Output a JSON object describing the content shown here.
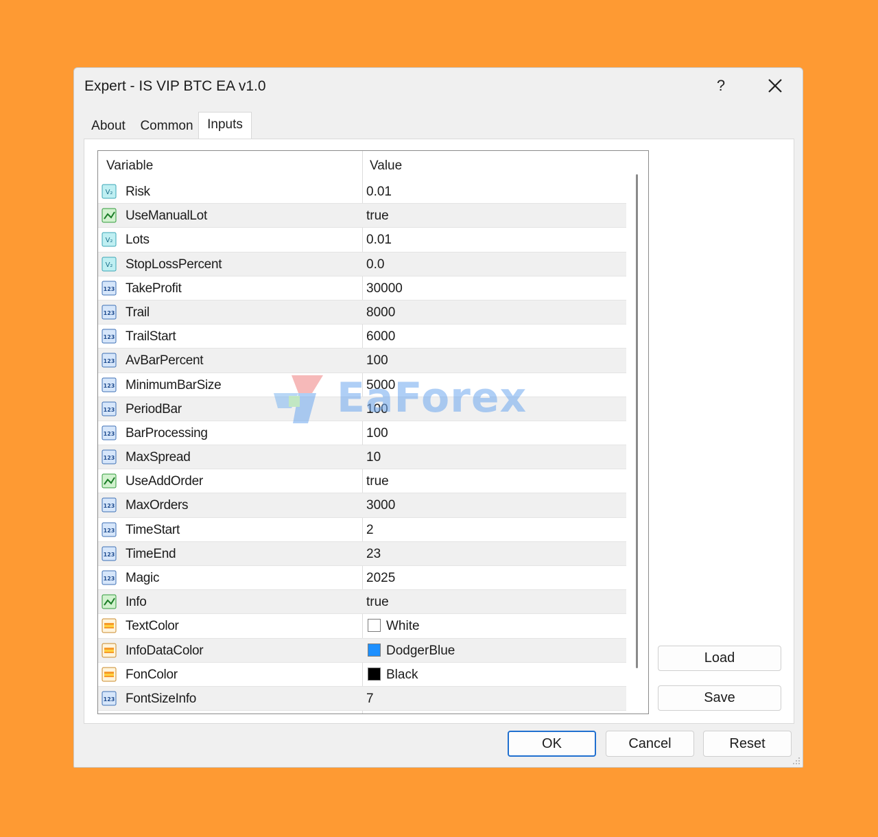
{
  "window": {
    "title": "Expert - IS VIP BTC EA v1.0",
    "help_label": "?",
    "close_label": "✕"
  },
  "tabs": [
    {
      "label": "About",
      "active": false
    },
    {
      "label": "Common",
      "active": false
    },
    {
      "label": "Inputs",
      "active": true
    }
  ],
  "grid": {
    "headers": {
      "variable": "Variable",
      "value": "Value"
    },
    "rows": [
      {
        "variable": "Risk",
        "value": "0.01",
        "icon": "double-icon"
      },
      {
        "variable": "UseManualLot",
        "value": "true",
        "icon": "bool-icon"
      },
      {
        "variable": "Lots",
        "value": "0.01",
        "icon": "double-icon"
      },
      {
        "variable": "StopLossPercent",
        "value": "0.0",
        "icon": "double-icon"
      },
      {
        "variable": "TakeProfit",
        "value": "30000",
        "icon": "int-icon"
      },
      {
        "variable": "Trail",
        "value": "8000",
        "icon": "int-icon"
      },
      {
        "variable": "TrailStart",
        "value": "6000",
        "icon": "int-icon"
      },
      {
        "variable": "AvBarPercent",
        "value": "100",
        "icon": "int-icon"
      },
      {
        "variable": "MinimumBarSize",
        "value": "5000",
        "icon": "int-icon"
      },
      {
        "variable": "PeriodBar",
        "value": "100",
        "icon": "int-icon"
      },
      {
        "variable": "BarProcessing",
        "value": "100",
        "icon": "int-icon"
      },
      {
        "variable": "MaxSpread",
        "value": "10",
        "icon": "int-icon"
      },
      {
        "variable": "UseAddOrder",
        "value": "true",
        "icon": "bool-icon"
      },
      {
        "variable": "MaxOrders",
        "value": "3000",
        "icon": "int-icon"
      },
      {
        "variable": "TimeStart",
        "value": "2",
        "icon": "int-icon"
      },
      {
        "variable": "TimeEnd",
        "value": "23",
        "icon": "int-icon"
      },
      {
        "variable": "Magic",
        "value": "2025",
        "icon": "int-icon"
      },
      {
        "variable": "Info",
        "value": "true",
        "icon": "bool-icon"
      },
      {
        "variable": "TextColor",
        "value": "White",
        "icon": "color-icon",
        "swatch": "#FFFFFF"
      },
      {
        "variable": "InfoDataColor",
        "value": "DodgerBlue",
        "icon": "color-icon",
        "swatch": "#1E90FF"
      },
      {
        "variable": "FonColor",
        "value": "Black",
        "icon": "color-icon",
        "swatch": "#000000"
      },
      {
        "variable": "FontSizeInfo",
        "value": "7",
        "icon": "int-icon"
      }
    ]
  },
  "side_buttons": {
    "load": "Load",
    "save": "Save"
  },
  "footer_buttons": {
    "ok": "OK",
    "cancel": "Cancel",
    "reset": "Reset"
  },
  "watermark": {
    "text": "EaForex"
  },
  "colors": {
    "accent": "#1F6FCF",
    "background": "#FE9A33"
  }
}
